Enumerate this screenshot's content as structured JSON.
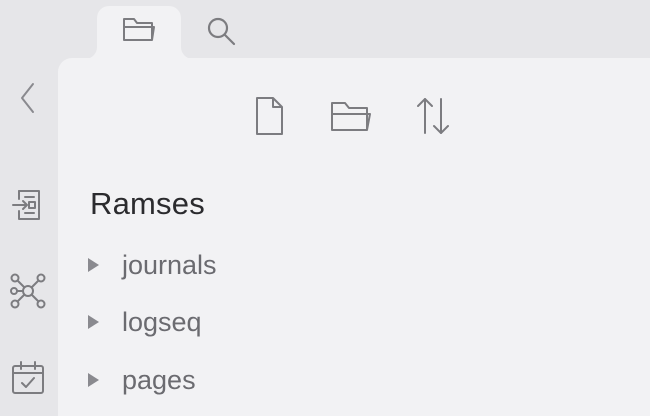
{
  "tabs": [
    {
      "icon": "folder-icon",
      "active": true
    },
    {
      "icon": "search-icon",
      "active": false
    }
  ],
  "ribbon": [
    {
      "icon": "chevron-left-icon"
    },
    {
      "icon": "import-document-icon"
    },
    {
      "icon": "graph-network-icon"
    },
    {
      "icon": "calendar-check-icon"
    }
  ],
  "toolbar": [
    {
      "icon": "new-note-icon"
    },
    {
      "icon": "new-folder-icon"
    },
    {
      "icon": "sort-icon"
    }
  ],
  "explorer": {
    "vault_name": "Ramses",
    "items": [
      {
        "label": "journals",
        "icon": "caret-right-icon"
      },
      {
        "label": "logseq",
        "icon": "caret-right-icon"
      },
      {
        "label": "pages",
        "icon": "caret-right-icon"
      }
    ]
  },
  "colors": {
    "background": "#e6e6e9",
    "panel": "#f2f2f4",
    "icon": "#7c7c80",
    "title_text": "#2b2b2e",
    "item_text": "#6b6b70"
  }
}
